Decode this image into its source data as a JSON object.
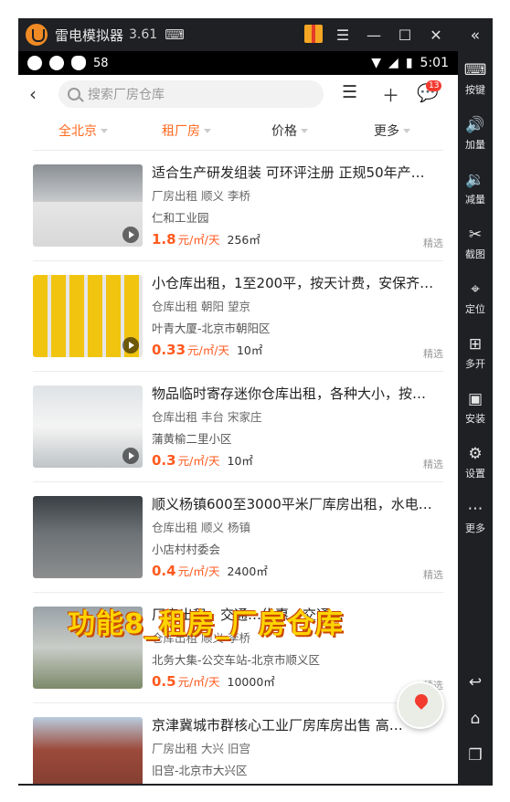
{
  "emulator": {
    "name": "雷电模拟器",
    "version": "3.61",
    "sidebar": [
      {
        "label": "按键",
        "icon": "keyboard-icon"
      },
      {
        "label": "加量",
        "icon": "volume-up-icon"
      },
      {
        "label": "减量",
        "icon": "volume-down-icon"
      },
      {
        "label": "截图",
        "icon": "scissors-icon"
      },
      {
        "label": "定位",
        "icon": "location-icon"
      },
      {
        "label": "多开",
        "icon": "multi-open-icon"
      },
      {
        "label": "安装",
        "icon": "apk-icon"
      },
      {
        "label": "设置",
        "icon": "gear-icon"
      },
      {
        "label": "更多",
        "icon": "more-icon"
      }
    ]
  },
  "statusbar": {
    "left_text": "58",
    "time": "5:01"
  },
  "app": {
    "search_placeholder": "搜索厂房仓库",
    "message_badge": "13",
    "filters": [
      {
        "label": "全北京",
        "active": true
      },
      {
        "label": "租厂房",
        "active": true
      },
      {
        "label": "价格",
        "active": false
      },
      {
        "label": "更多",
        "active": false
      }
    ],
    "listings": [
      {
        "title": "适合生产研发组装 可环评注册 正规50年产…",
        "meta": "厂房出租 顺义 李桥",
        "location": "仁和工业园",
        "price": "1.8",
        "unit": "元/㎡/天",
        "area": "256㎡",
        "tag": "精选"
      },
      {
        "title": "小仓库出租，1至200平，按天计费，安保齐…",
        "meta": "仓库出租 朝阳 望京",
        "location": "叶青大厦-北京市朝阳区",
        "price": "0.33",
        "unit": "元/㎡/天",
        "area": "10㎡",
        "tag": "精选"
      },
      {
        "title": "物品临时寄存迷你仓库出租，各种大小，按…",
        "meta": "仓库出租 丰台 宋家庄",
        "location": "蒲黄榆二里小区",
        "price": "0.3",
        "unit": "元/㎡/天",
        "area": "10㎡",
        "tag": "精选"
      },
      {
        "title": "顺义杨镇600至3000平米厂库房出租，水电…",
        "meta": "仓库出租 顺义 杨镇",
        "location": "小店村村委会",
        "price": "0.4",
        "unit": "元/㎡/天",
        "area": "2400㎡",
        "tag": "精选"
      },
      {
        "title": "厂房出租，交通…优惠，交通…",
        "meta": "仓库出租 顺义 李桥",
        "location": "北务大集-公交车站-北京市顺义区",
        "price": "0.5",
        "unit": "元/㎡/天",
        "area": "10000㎡",
        "tag": "精选"
      },
      {
        "title": "京津冀城市群核心工业厂房库房出售 高…",
        "meta": "厂房出租 大兴 旧宫",
        "location": "旧宫-北京市大兴区",
        "price": "",
        "unit": "",
        "area": "",
        "tag": ""
      }
    ],
    "watermark": "功能8_租房_厂房仓库"
  }
}
